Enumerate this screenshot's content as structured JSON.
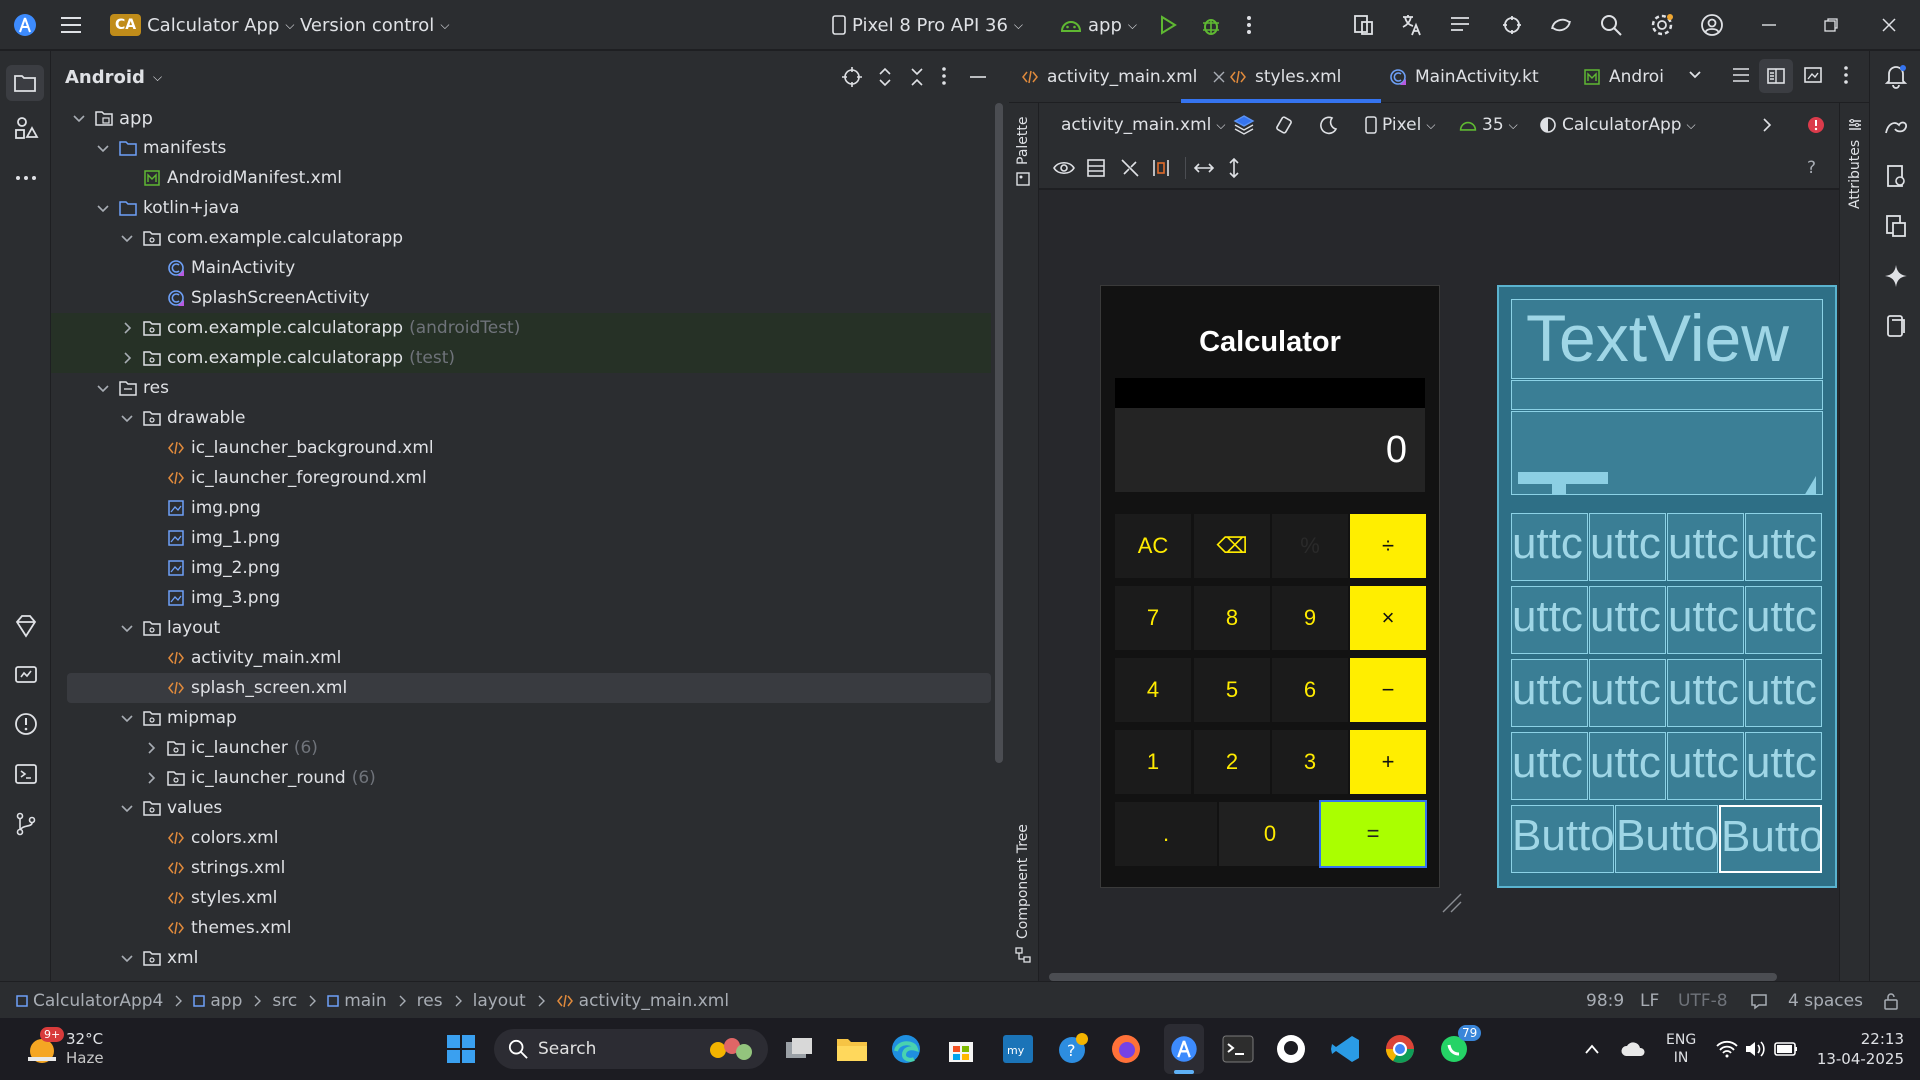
{
  "title_bar": {
    "project_badge": "CA",
    "project_name": "Calculator App",
    "vcs_label": "Version control",
    "device_label": "Pixel 8 Pro API 36",
    "run_config": "app"
  },
  "project_panel": {
    "view_label": "Android",
    "tree": [
      {
        "label": "app",
        "hint": "",
        "icon": "module-folder-icon",
        "level": 0,
        "expanded": true
      },
      {
        "label": "manifests",
        "hint": "",
        "icon": "folder-icon",
        "level": 1,
        "expanded": true
      },
      {
        "label": "AndroidManifest.xml",
        "hint": "",
        "icon": "manifest-file-icon",
        "level": 2,
        "expanded": null
      },
      {
        "label": "kotlin+java",
        "hint": "",
        "icon": "folder-icon",
        "level": 1,
        "expanded": true
      },
      {
        "label": "com.example.calculatorapp",
        "hint": "",
        "icon": "package-icon",
        "level": 2,
        "expanded": true
      },
      {
        "label": "MainActivity",
        "hint": "",
        "icon": "kotlin-class-icon",
        "level": 3,
        "expanded": null
      },
      {
        "label": "SplashScreenActivity",
        "hint": "",
        "icon": "kotlin-class-icon",
        "level": 3,
        "expanded": null
      },
      {
        "label": "com.example.calculatorapp",
        "hint": "(androidTest)",
        "icon": "package-icon",
        "level": 2,
        "expanded": false
      },
      {
        "label": "com.example.calculatorapp",
        "hint": "(test)",
        "icon": "package-icon",
        "level": 2,
        "expanded": false
      },
      {
        "label": "res",
        "hint": "",
        "icon": "res-folder-icon",
        "level": 1,
        "expanded": true
      },
      {
        "label": "drawable",
        "hint": "",
        "icon": "package-icon",
        "level": 2,
        "expanded": true
      },
      {
        "label": "ic_launcher_background.xml",
        "hint": "",
        "icon": "xml-file-icon",
        "level": 3,
        "expanded": null
      },
      {
        "label": "ic_launcher_foreground.xml",
        "hint": "",
        "icon": "xml-file-icon",
        "level": 3,
        "expanded": null
      },
      {
        "label": "img.png",
        "hint": "",
        "icon": "image-file-icon",
        "level": 3,
        "expanded": null
      },
      {
        "label": "img_1.png",
        "hint": "",
        "icon": "image-file-icon",
        "level": 3,
        "expanded": null
      },
      {
        "label": "img_2.png",
        "hint": "",
        "icon": "image-file-icon",
        "level": 3,
        "expanded": null
      },
      {
        "label": "img_3.png",
        "hint": "",
        "icon": "image-file-icon",
        "level": 3,
        "expanded": null
      },
      {
        "label": "layout",
        "hint": "",
        "icon": "package-icon",
        "level": 2,
        "expanded": true
      },
      {
        "label": "activity_main.xml",
        "hint": "",
        "icon": "xml-file-icon",
        "level": 3,
        "expanded": null
      },
      {
        "label": "splash_screen.xml",
        "hint": "",
        "icon": "xml-file-icon",
        "level": 3,
        "expanded": null
      },
      {
        "label": "mipmap",
        "hint": "",
        "icon": "package-icon",
        "level": 2,
        "expanded": true
      },
      {
        "label": "ic_launcher",
        "hint": "(6)",
        "icon": "package-icon",
        "level": 3,
        "expanded": false
      },
      {
        "label": "ic_launcher_round",
        "hint": "(6)",
        "icon": "package-icon",
        "level": 3,
        "expanded": false
      },
      {
        "label": "values",
        "hint": "",
        "icon": "package-icon",
        "level": 2,
        "expanded": true
      },
      {
        "label": "colors.xml",
        "hint": "",
        "icon": "xml-file-icon",
        "level": 3,
        "expanded": null
      },
      {
        "label": "strings.xml",
        "hint": "",
        "icon": "xml-file-icon",
        "level": 3,
        "expanded": null
      },
      {
        "label": "styles.xml",
        "hint": "",
        "icon": "xml-file-icon",
        "level": 3,
        "expanded": null
      },
      {
        "label": "themes.xml",
        "hint": "",
        "icon": "xml-file-icon",
        "level": 3,
        "expanded": null
      },
      {
        "label": "xml",
        "hint": "",
        "icon": "package-icon",
        "level": 2,
        "expanded": true
      }
    ]
  },
  "editor_tabs": [
    {
      "label": "activity_main.xml",
      "icon": "xml-file-icon",
      "active": true,
      "closable": true
    },
    {
      "label": "styles.xml",
      "icon": "xml-file-icon",
      "active": false,
      "closable": false
    },
    {
      "label": "MainActivity.kt",
      "icon": "kotlin-class-icon",
      "active": false,
      "closable": false
    },
    {
      "label": "Androi",
      "icon": "manifest-file-icon",
      "active": false,
      "closable": false
    }
  ],
  "side_tools": {
    "palette": "Palette",
    "component_tree": "Component Tree",
    "attributes": "Attributes"
  },
  "design_toolbar": {
    "file": "activity_main.xml",
    "device": "Pixel",
    "api": "35",
    "theme": "CalculatorApp",
    "help": "?"
  },
  "phone_preview": {
    "title": "Calculator",
    "display": "0",
    "rows": [
      [
        "AC",
        "⌫",
        "%",
        "÷"
      ],
      [
        "7",
        "8",
        "9",
        "×"
      ],
      [
        "4",
        "5",
        "6",
        "−"
      ],
      [
        "1",
        "2",
        "3",
        "+"
      ],
      [
        ".",
        "0",
        "="
      ]
    ]
  },
  "blueprint": {
    "textview": "TextView",
    "button_text": "uttc",
    "bottom_button_text": "Butto"
  },
  "breadcrumbs": [
    "CalculatorApp4",
    "app",
    "src",
    "main",
    "res",
    "layout",
    "activity_main.xml"
  ],
  "status_right": {
    "position": "98:9",
    "line_sep": "LF",
    "encoding": "UTF-8",
    "indent": "4 spaces"
  },
  "taskbar": {
    "weather_temp": "32°C",
    "weather_desc": "Haze",
    "weather_badge": "9+",
    "search_label": "Search",
    "whatsapp_badge": "79",
    "lang_top": "ENG",
    "lang_bottom": "IN",
    "time": "22:13",
    "date": "13-04-2025"
  },
  "colors": {
    "accent": "#3574f0",
    "yellow_button": "#ffee00",
    "equals_button": "#aaff00",
    "blueprint": "#2e6f86"
  }
}
